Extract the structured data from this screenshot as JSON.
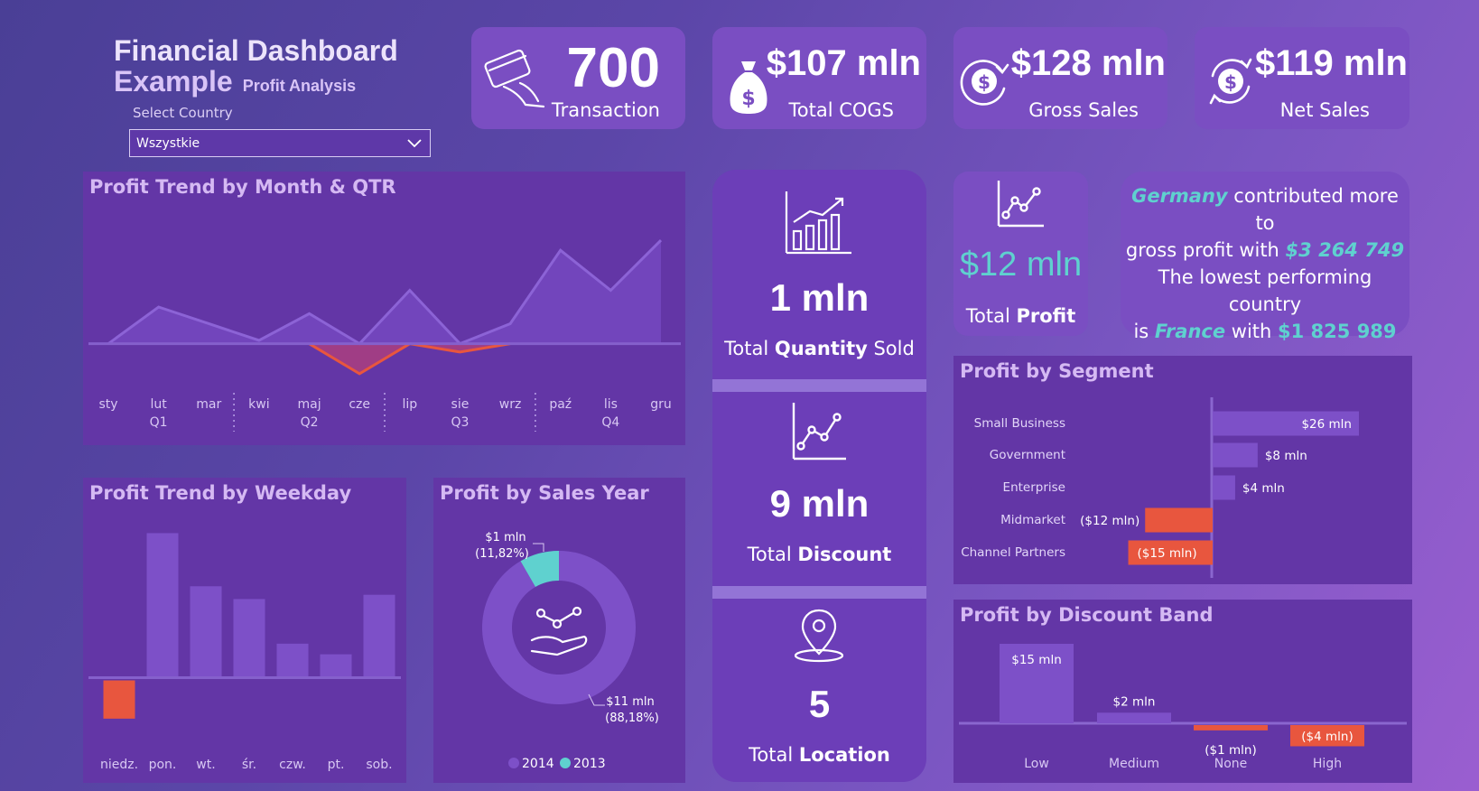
{
  "header": {
    "title_line1": "Financial Dashboard",
    "title_line2": "Example",
    "subtitle": "Profit Analysis",
    "select_label": "Select Country",
    "select_value": "Wszystkie"
  },
  "kpis": [
    {
      "value": "700",
      "label": "Transaction",
      "icon": "credit-card-hand-icon"
    },
    {
      "value": "$107 mln",
      "label": "Total COGS",
      "icon": "money-bag-icon"
    },
    {
      "value": "$128 mln",
      "label": "Gross Sales",
      "icon": "dollar-cycle-icon"
    },
    {
      "value": "$119 mln",
      "label": "Net Sales",
      "icon": "dollar-refresh-icon"
    }
  ],
  "center_cards": {
    "quantity": {
      "value": "1 mln",
      "prefix": "Total ",
      "bold": "Quantity",
      "suffix": " Sold"
    },
    "discount": {
      "value": "9 mln",
      "prefix": "Total ",
      "bold": "Discount"
    },
    "location": {
      "value": "5",
      "prefix": "Total ",
      "bold": "Location"
    }
  },
  "profit_card": {
    "value": "$12 mln",
    "prefix": "Total ",
    "bold": "Profit"
  },
  "insight": {
    "best_country": "Germany",
    "text1": " contributed more to",
    "text2": "gross profit with ",
    "best_value": "$3 264 749",
    "text3": "The lowest performing country",
    "text4": "is ",
    "worst_country": "France",
    "text5": " with ",
    "worst_value": "$1 825 989"
  },
  "colors": {
    "accent_teal": "#5fd1cf",
    "bar": "#7d50c8",
    "negative": "#e8563e",
    "panel": "#6336a6"
  },
  "chart_data": [
    {
      "id": "trend_month",
      "type": "area",
      "title": "Profit Trend by Month & QTR",
      "categories": [
        "sty",
        "lut",
        "mar",
        "kwi",
        "maj",
        "cze",
        "lip",
        "sie",
        "wrz",
        "paź",
        "lis",
        "gru"
      ],
      "quarters": [
        "Q1",
        "Q2",
        "Q3",
        "Q4"
      ],
      "values": [
        0,
        1.1,
        0.6,
        0.1,
        0.9,
        -0.9,
        1.6,
        -0.25,
        0.6,
        2.8,
        1.6,
        3.1
      ],
      "ylim": [
        -1.2,
        3.4
      ]
    },
    {
      "id": "trend_weekday",
      "type": "bar",
      "title": "Profit Trend by Weekday",
      "categories": [
        "niedz.",
        "pon.",
        "wt.",
        "śr.",
        "czw.",
        "pt.",
        "sob."
      ],
      "values": [
        -0.9,
        3.4,
        2.15,
        1.85,
        0.8,
        0.55,
        1.95
      ],
      "ylim": [
        -1.2,
        3.6
      ]
    },
    {
      "id": "sales_year",
      "type": "pie",
      "title": "Profit by Sales Year",
      "categories": [
        "2014",
        "2013"
      ],
      "values": [
        11,
        1
      ],
      "labels": [
        "$11 mln",
        "$1 mln"
      ],
      "percents": [
        "(88,18%)",
        "(11,82%)"
      ],
      "colors": [
        "#7d50c8",
        "#5fd1cf"
      ]
    },
    {
      "id": "segment",
      "type": "bar",
      "title": "Profit by Segment",
      "categories": [
        "Small Business",
        "Government",
        "Enterprise",
        "Midmarket",
        "Channel Partners"
      ],
      "values": [
        26,
        8,
        4,
        -12,
        -15
      ],
      "labels": [
        "$26 mln",
        "$8 mln",
        "$4 mln",
        "($12 mln)",
        "($15 mln)"
      ]
    },
    {
      "id": "discount_band",
      "type": "bar",
      "title": "Profit by Discount Band",
      "categories": [
        "Low",
        "Medium",
        "None",
        "High"
      ],
      "values": [
        15,
        2,
        -1,
        -4
      ],
      "labels": [
        "$15 mln",
        "$2 mln",
        "($1 mln)",
        "($4 mln)"
      ]
    }
  ]
}
